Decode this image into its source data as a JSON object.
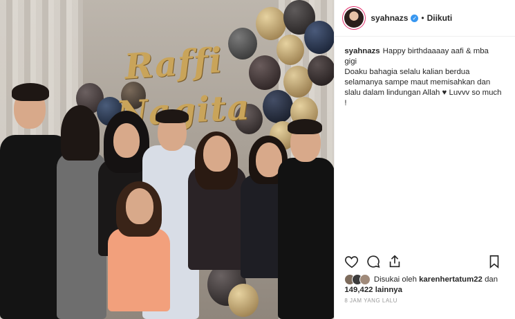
{
  "post": {
    "username": "syahnazs",
    "follow_status": "Diikuti",
    "caption_text": "Happy birthdaaaay aafi & mba gigi\nDoaku bahagia selalu kalian berdua selamanya sampe maut memisahkan dan slalu dalam lindungan Allah ♥ Luvvv so much !",
    "liked_by_prefix": "Disukai oleh",
    "liked_by_user": "karenhertatum22",
    "liked_by_conj": "dan",
    "likes_count": "149,422",
    "likes_suffix": "lainnya",
    "timestamp": "8 JAM YANG LALU"
  },
  "photo": {
    "sign_line1": "Raffi",
    "sign_line2": "Nagita"
  },
  "icons": {
    "like": "heart-icon",
    "comment": "comment-icon",
    "share": "share-icon",
    "save": "bookmark-icon",
    "verified": "verified-badge-icon"
  },
  "colors": {
    "accent_blue": "#3897f0",
    "text": "#262626",
    "muted": "#999999",
    "gold": "#c9a45a"
  }
}
